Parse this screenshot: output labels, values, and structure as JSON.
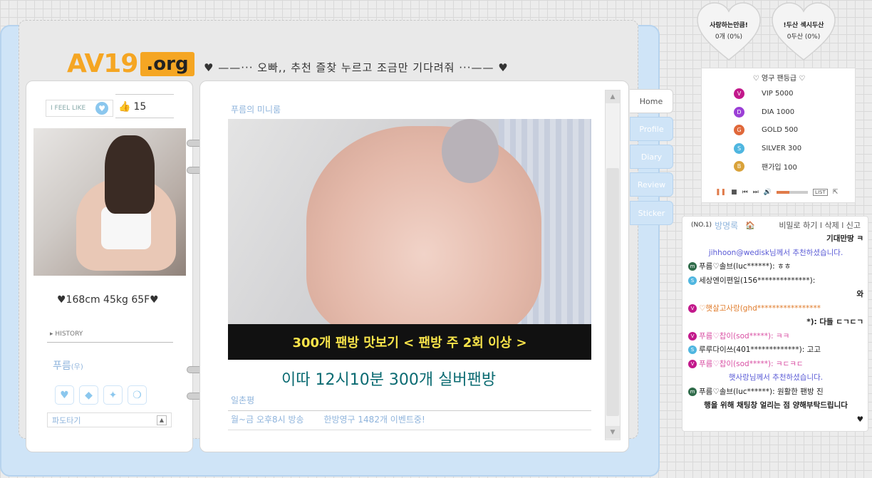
{
  "brand": {
    "name": "AV19",
    "tld": ".org"
  },
  "headline": "♥ ——··· 오빠,, 추천 즐찾 누르고 조금만 기다려줘 ···—— ♥",
  "left": {
    "feel_label": "I FEEL LIKE",
    "likes": "15",
    "stats": "♥168cm 45kg 65F♥",
    "history": "HISTORY",
    "nickname": "푸름",
    "nickname_suffix": "(우)",
    "wave_label": "파도타기"
  },
  "main": {
    "room_title": "푸름의 미니룸",
    "video_caption": "300개 팬방 맛보기 < 팬방 주 2회 이상 >",
    "overlay_text": "이따 12시10분 300개 실버팬방",
    "review_title": "일촌평",
    "review_items": [
      "월~금 오후8시 방송",
      "한방영구 1482개 이벤트중!"
    ]
  },
  "tabs": [
    "Home",
    "Profile",
    "Diary",
    "Review",
    "Sticker"
  ],
  "hearts": [
    {
      "title": "사랑하는만큼!",
      "sub": "0개 (0%)"
    },
    {
      "title": "!두산 섹시두산",
      "sub": "0두산 (0%)"
    }
  ],
  "ranking": {
    "title": "♡ 영구 팬등급 ♡",
    "rows": [
      {
        "badge": "V",
        "label": "VIP 5000",
        "color": "#c2188b"
      },
      {
        "badge": "D",
        "label": "DIA 1000",
        "color": "#9b3fd6"
      },
      {
        "badge": "G",
        "label": "GOLD 500",
        "color": "#e0683a"
      },
      {
        "badge": "S",
        "label": "SILVER 300",
        "color": "#4fb6e0"
      },
      {
        "badge": "B",
        "label": "팬가입 100",
        "color": "#d9a23a"
      }
    ],
    "player_list": "LIST"
  },
  "guestbook": {
    "no": "(NO.1)",
    "title": "방명록",
    "actions": "비밀로 하기 l 삭제 l 신고",
    "lines": [
      {
        "text": "기대만땅 ㅋ",
        "style": "bold right",
        "badge": "",
        "badge_color": ""
      },
      {
        "text": "jihhoon@wedisk님께서 추천하셨습니다.",
        "style": "blue",
        "badge": "",
        "badge_color": ""
      },
      {
        "text": "푸름♡솔브(luc******): ㅎㅎ",
        "style": "",
        "badge": "m",
        "badge_color": "#2f6b4a"
      },
      {
        "text": "세상엔이편일(156**************):",
        "style": "",
        "badge": "S",
        "badge_color": "#4fb6e0"
      },
      {
        "text": "와",
        "style": "bold right",
        "badge": "",
        "badge_color": ""
      },
      {
        "text": "♡햇살고사랑(ghd*****************",
        "style": "orange",
        "badge": "V",
        "badge_color": "#c2188b"
      },
      {
        "text": "*): 다들 ㄷㄱㄷㄱ",
        "style": "bold right",
        "badge": "",
        "badge_color": ""
      },
      {
        "text": "푸름♡찹이(sod*****): ㅋㅋ",
        "style": "pink",
        "badge": "V",
        "badge_color": "#c2188b"
      },
      {
        "text": "루루다이쓰(401*************): 고고",
        "style": "",
        "badge": "S",
        "badge_color": "#4fb6e0"
      },
      {
        "text": "푸름♡찹이(sod*****): ㅋㄷㅋㄷ",
        "style": "pink",
        "badge": "V",
        "badge_color": "#c2188b"
      },
      {
        "text": "햇사랑님께서 추천하셨습니다.",
        "style": "blue",
        "badge": "",
        "badge_color": ""
      },
      {
        "text": "푸름♡솔브(luc******): 원활한 팬방 진",
        "style": "",
        "badge": "m",
        "badge_color": "#2f6b4a"
      },
      {
        "text": "행을 위해 채팅창 얼리는 점 양해부탁드립니다",
        "style": "bold",
        "badge": "",
        "badge_color": ""
      },
      {
        "text": "♥",
        "style": "right",
        "badge": "",
        "badge_color": ""
      }
    ]
  }
}
